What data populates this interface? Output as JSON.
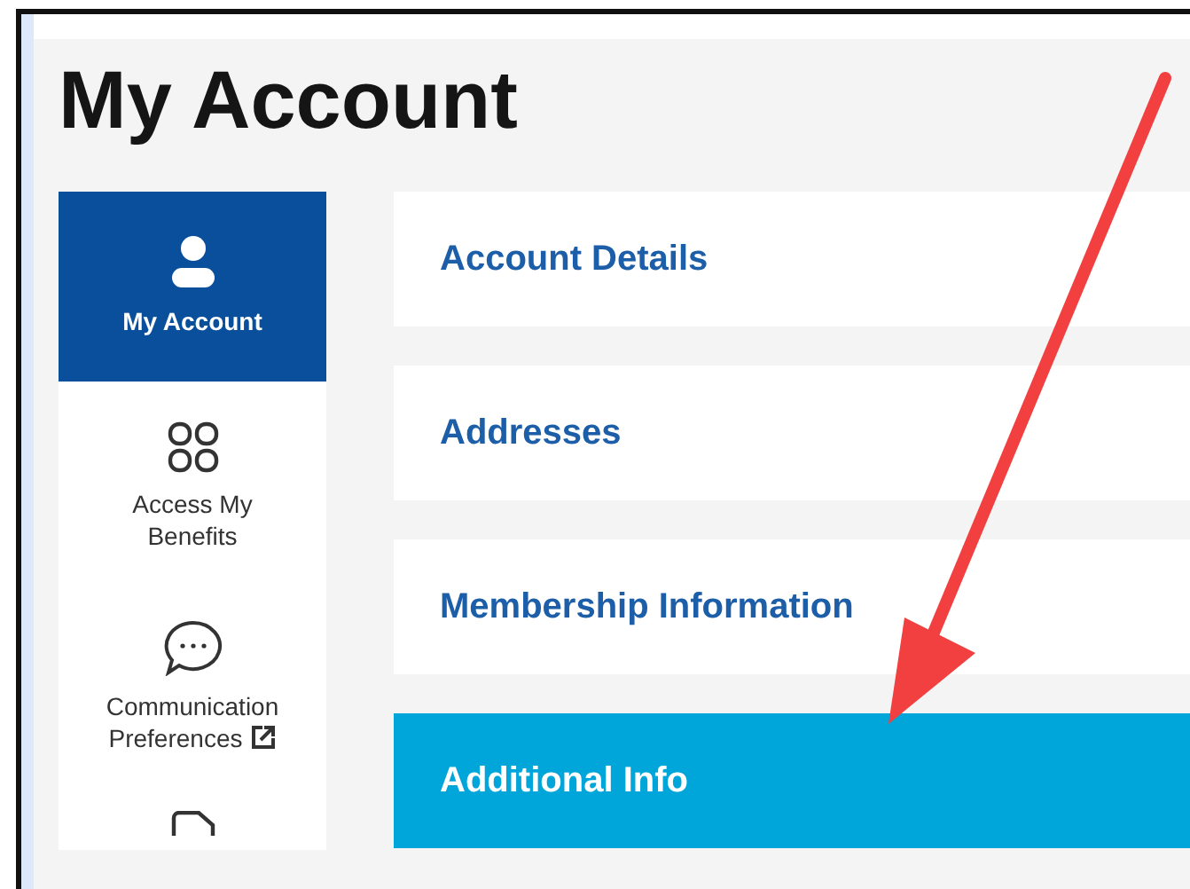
{
  "page": {
    "title": "My Account"
  },
  "sidebar": {
    "items": [
      {
        "label": "My Account",
        "selected": true,
        "external": false
      },
      {
        "label": "Access My Benefits",
        "selected": false,
        "external": false
      },
      {
        "label": "Communication Preferences",
        "selected": false,
        "external": true
      },
      {
        "selected": false,
        "external": false
      }
    ]
  },
  "sections": [
    {
      "label": "Account Details",
      "selected": false
    },
    {
      "label": "Addresses",
      "selected": false
    },
    {
      "label": "Membership Information",
      "selected": false
    },
    {
      "label": "Additional Info",
      "selected": true
    }
  ]
}
